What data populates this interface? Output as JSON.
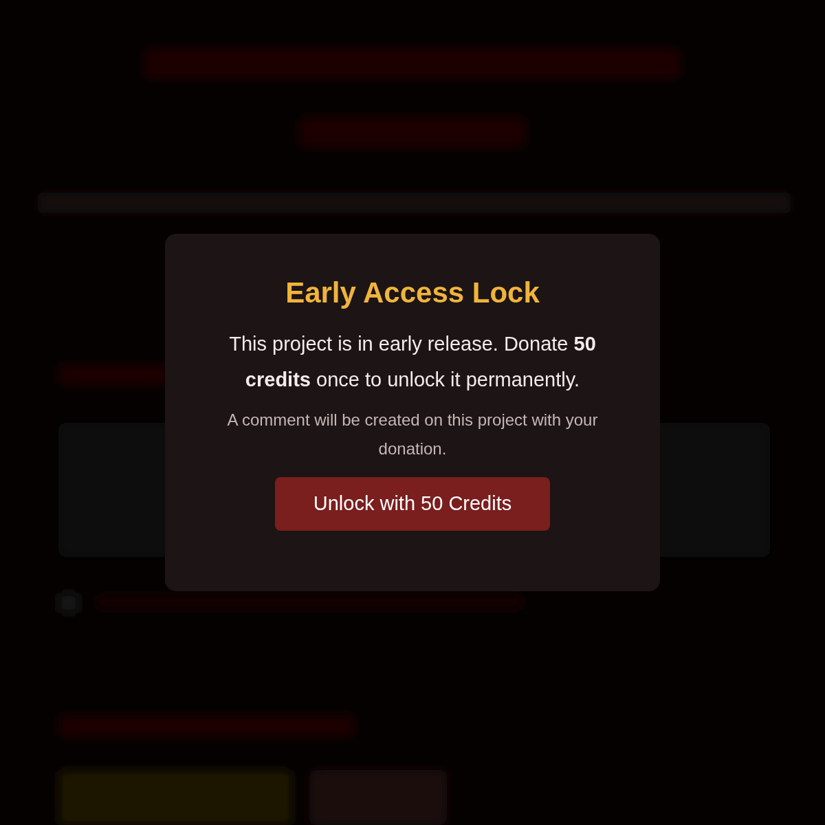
{
  "dialog": {
    "title": "Early Access Lock",
    "message": "This project is in early release. Donate **50 credits** once to unlock it permanently.",
    "note": "A comment will be created on this project with your donation.",
    "button": "Unlock with 50 Credits"
  }
}
